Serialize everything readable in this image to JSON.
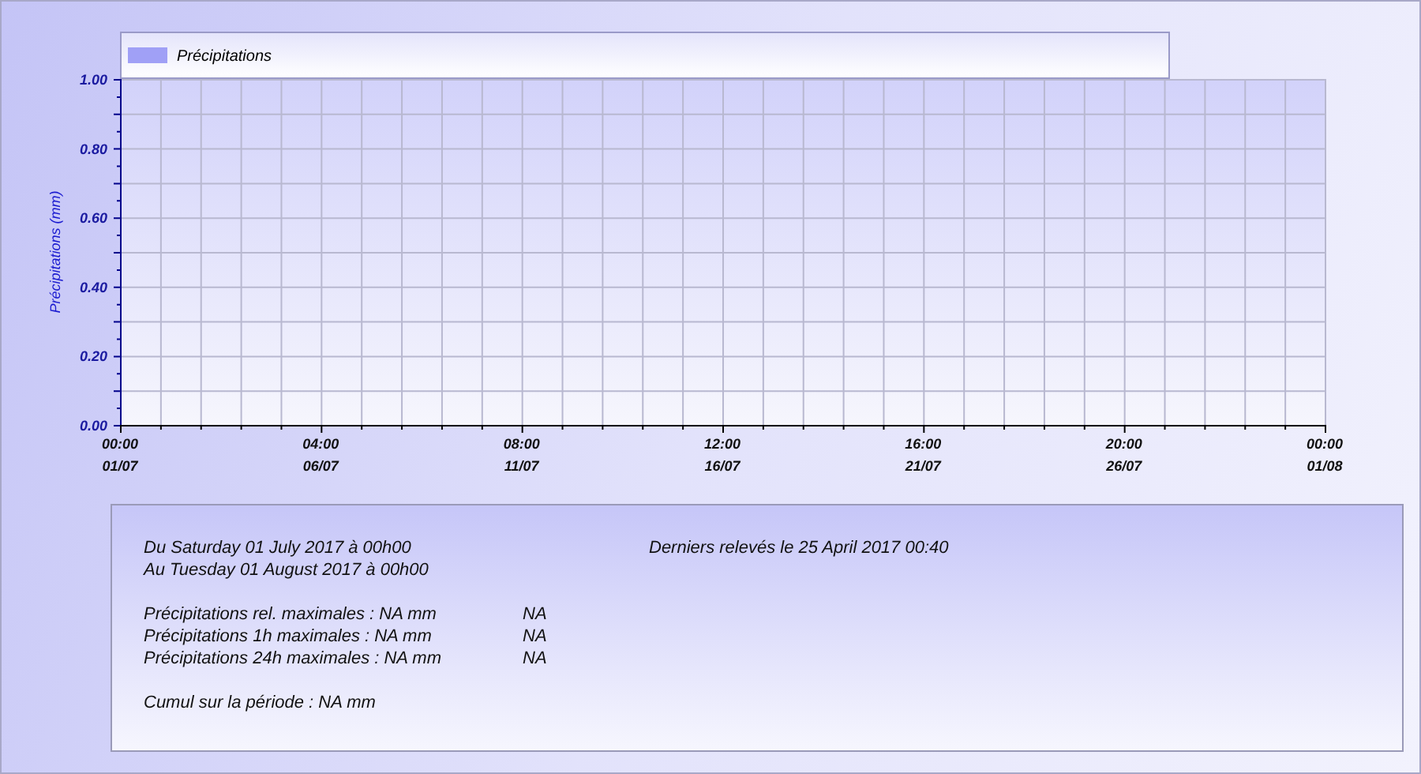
{
  "chart": {
    "chart_data": {
      "type": "bar",
      "ylabel": "Précipitations (mm)",
      "ylim": [
        0,
        1
      ],
      "grid": true,
      "series": [
        {
          "name": "Précipitations",
          "color": "#a0a0f6",
          "values": [
            null,
            null,
            null,
            null,
            null,
            null,
            null
          ]
        }
      ],
      "yticks": [
        {
          "value": 0,
          "label": "0.00"
        },
        {
          "value": 0.2,
          "label": "0.20"
        },
        {
          "value": 0.4,
          "label": "0.40"
        },
        {
          "value": 0.6,
          "label": "0.60"
        },
        {
          "value": 0.8,
          "label": "0.80"
        },
        {
          "value": 1,
          "label": "1.00"
        }
      ],
      "categories": [
        "00:00\n01/07",
        "04:00\n06/07",
        "08:00\n11/07",
        "12:00\n16/07",
        "16:00\n21/07",
        "20:00\n26/07",
        "00:00\n01/08"
      ]
    }
  },
  "summary": {
    "period": [
      "Du Saturday 01 July 2017 à 00h00",
      "Au Tuesday 01 August 2017 à 00h00"
    ],
    "last_reading": "Derniers relevés le 25 April 2017 00:40",
    "maxima": [
      {
        "label": "Précipitations rel. maximales : NA mm",
        "when": "NA"
      },
      {
        "label": "Précipitations 1h maximales : NA mm",
        "when": "NA"
      },
      {
        "label": "Précipitations 24h maximales : NA mm",
        "when": "NA"
      }
    ],
    "cumul": "Cumul sur la période : NA mm"
  }
}
